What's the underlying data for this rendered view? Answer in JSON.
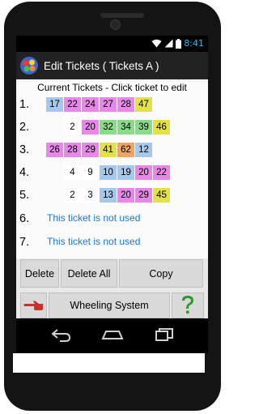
{
  "status": {
    "time": "8:41"
  },
  "app": {
    "title": "Edit Tickets ( Tickets A )"
  },
  "header": "Current Tickets - Click ticket to edit",
  "tickets": [
    {
      "num": "1.",
      "cells": [
        {
          "v": "17",
          "c": "#a5c8ef"
        },
        {
          "v": "22",
          "c": "#e887e8"
        },
        {
          "v": "24",
          "c": "#e887e8"
        },
        {
          "v": "27",
          "c": "#e887e8"
        },
        {
          "v": "28",
          "c": "#e887e8"
        },
        {
          "v": "47",
          "c": "#e2e247"
        }
      ]
    },
    {
      "num": "2.",
      "cells": [
        {
          "v": "",
          "c": "transparent"
        },
        {
          "v": "2",
          "c": "#ffffff"
        },
        {
          "v": "20",
          "c": "#e887e8"
        },
        {
          "v": "32",
          "c": "#88dc88"
        },
        {
          "v": "34",
          "c": "#88dc88"
        },
        {
          "v": "39",
          "c": "#88dc88"
        },
        {
          "v": "46",
          "c": "#e2e247"
        }
      ]
    },
    {
      "num": "3.",
      "cells": [
        {
          "v": "26",
          "c": "#e887e8"
        },
        {
          "v": "28",
          "c": "#e887e8"
        },
        {
          "v": "29",
          "c": "#e887e8"
        },
        {
          "v": "41",
          "c": "#e2e247"
        },
        {
          "v": "62",
          "c": "#f2a35e"
        },
        {
          "v": "12",
          "c": "#a5c8ef"
        }
      ]
    },
    {
      "num": "4.",
      "cells": [
        {
          "v": "",
          "c": "transparent"
        },
        {
          "v": "4",
          "c": "#ffffff"
        },
        {
          "v": "9",
          "c": "#ffffff"
        },
        {
          "v": "10",
          "c": "#a5c8ef"
        },
        {
          "v": "19",
          "c": "#a5c8ef"
        },
        {
          "v": "20",
          "c": "#e887e8"
        },
        {
          "v": "22",
          "c": "#e887e8"
        }
      ]
    },
    {
      "num": "5.",
      "cells": [
        {
          "v": "",
          "c": "transparent"
        },
        {
          "v": "2",
          "c": "#ffffff"
        },
        {
          "v": "3",
          "c": "#ffffff"
        },
        {
          "v": "13",
          "c": "#a5c8ef"
        },
        {
          "v": "20",
          "c": "#e887e8"
        },
        {
          "v": "29",
          "c": "#e887e8"
        },
        {
          "v": "45",
          "c": "#e2e247"
        }
      ]
    }
  ],
  "unused_rows": [
    {
      "num": "6.",
      "text": "This ticket is not used"
    },
    {
      "num": "7.",
      "text": "This ticket is not used"
    }
  ],
  "buttons": {
    "delete": "Delete",
    "delete_all": "Delete All",
    "copy": "Copy",
    "wheeling": "Wheeling System"
  },
  "icons": {
    "pointer": "pointing-hand-icon",
    "help": "question-mark-icon"
  }
}
